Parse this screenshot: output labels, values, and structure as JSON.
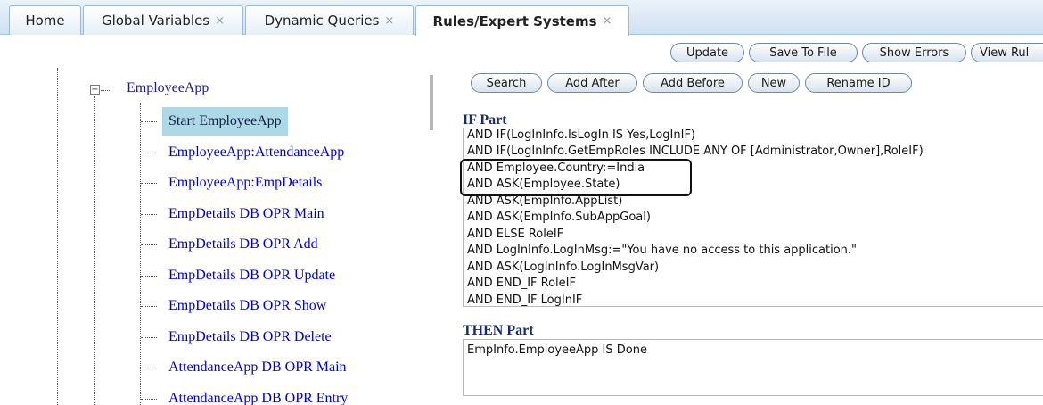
{
  "tabs": [
    {
      "label": "Home",
      "closable": false,
      "active": false
    },
    {
      "label": "Global Variables",
      "closable": true,
      "active": false
    },
    {
      "label": "Dynamic Queries",
      "closable": true,
      "active": false
    },
    {
      "label": "Rules/Expert Systems",
      "closable": true,
      "active": true
    }
  ],
  "close_glyph": "×",
  "toolbar": {
    "update": "Update",
    "save_to_file": "Save To File",
    "show_errors": "Show Errors",
    "view_rules": "View Rul"
  },
  "rule_toolbar": {
    "search": "Search",
    "add_after": "Add After",
    "add_before": "Add Before",
    "new": "New",
    "rename_id": "Rename ID"
  },
  "tree": {
    "expander_glyph": "−",
    "root": "EmployeeApp",
    "items": [
      {
        "label": "Start EmployeeApp",
        "selected": true
      },
      {
        "label": "EmployeeApp:AttendanceApp",
        "selected": false
      },
      {
        "label": "EmployeeApp:EmpDetails",
        "selected": false
      },
      {
        "label": "EmpDetails DB OPR Main",
        "selected": false
      },
      {
        "label": "EmpDetails DB OPR Add",
        "selected": false
      },
      {
        "label": "EmpDetails DB OPR Update",
        "selected": false
      },
      {
        "label": "EmpDetails DB OPR Show",
        "selected": false
      },
      {
        "label": "EmpDetails DB OPR Delete",
        "selected": false
      },
      {
        "label": "AttendanceApp DB OPR Main",
        "selected": false
      },
      {
        "label": "AttendanceApp DB OPR Entry",
        "selected": false
      }
    ]
  },
  "if_part": {
    "title": "IF Part",
    "lines": [
      "AND IF(LogInInfo.IsLogIn IS Yes,LogInIF)",
      "AND IF(LogInInfo.GetEmpRoles INCLUDE ANY OF [Administrator,Owner],RoleIF)",
      "AND Employee.Country:=India",
      "AND ASK(Employee.State)",
      "AND ASK(EmpInfo.AppList)",
      "AND ASK(EmpInfo.SubAppGoal)",
      "AND ELSE RoleIF",
      "AND LogInInfo.LogInMsg:=\"You have no access to this application.\"",
      "AND ASK(LogInInfo.LogInMsgVar)",
      "AND END_IF RoleIF",
      "AND END_IF LogInIF"
    ]
  },
  "then_part": {
    "title": "THEN Part",
    "lines": [
      "EmpInfo.EmployeeApp IS Done"
    ]
  },
  "colors": {
    "tab_bar": "#cfe1f1",
    "tree_link": "#0000cc",
    "tree_selected_bg": "#add8e6",
    "section_title": "#1a2a6a",
    "highlight_border": "#111111"
  }
}
